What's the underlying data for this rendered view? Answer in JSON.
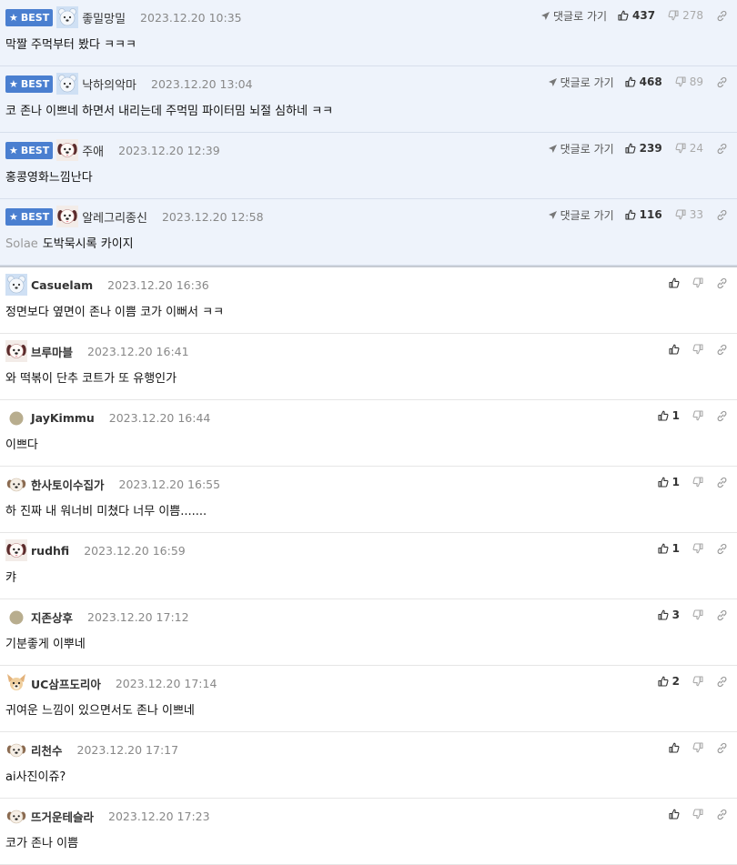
{
  "labels": {
    "best_badge": "BEST",
    "goto_comment": "댓글로 가기"
  },
  "colors": {
    "best_badge_bg": "#4a7fd0",
    "best_row_bg": "#eef3fb"
  },
  "best_comments": [
    {
      "nick": "좋밀망밀",
      "date": "2023.12.20 10:35",
      "text": "막짤 주먹부터 봤다 ㅋㅋㅋ",
      "tag": "",
      "up": "437",
      "down": "278",
      "avatar": "bear-avatar"
    },
    {
      "nick": "낙하의악마",
      "date": "2023.12.20 13:04",
      "text": "코 존나 이쁘네 하면서 내리는데 주먹밈 파이터밈 뇌절 심하네 ㅋㅋ",
      "tag": "",
      "up": "468",
      "down": "89",
      "avatar": "bear-avatar"
    },
    {
      "nick": "주애",
      "date": "2023.12.20 12:39",
      "text": "홍콩영화느낌난다",
      "tag": "",
      "up": "239",
      "down": "24",
      "avatar": "dog-avatar"
    },
    {
      "nick": "알레그리종신",
      "date": "2023.12.20 12:58",
      "text": "도박묵시록 카이지",
      "tag": "Solae",
      "up": "116",
      "down": "33",
      "avatar": "dog-avatar"
    }
  ],
  "comments": [
    {
      "nick": "Casuelam",
      "date": "2023.12.20 16:36",
      "text": "정면보다 옆면이 존나 이쁨 코가 이뻐서 ㅋㅋ",
      "up": "",
      "avatar": "bear-avatar"
    },
    {
      "nick": "브루마블",
      "date": "2023.12.20 16:41",
      "text": "와 떡볶이 단추 코트가 또 유행인가",
      "up": "",
      "avatar": "dog-avatar"
    },
    {
      "nick": "JayKimmu",
      "date": "2023.12.20 16:44",
      "text": "이쁘다",
      "up": "1",
      "avatar": "dot-avatar"
    },
    {
      "nick": "한사토이수집가",
      "date": "2023.12.20 16:55",
      "text": "하 진짜 내 워너비 미쳤다 너무 이쁨.......",
      "up": "1",
      "avatar": "puppy-avatar"
    },
    {
      "nick": "rudhfi",
      "date": "2023.12.20 16:59",
      "text": "캬",
      "up": "1",
      "avatar": "dog-avatar"
    },
    {
      "nick": "지존상후",
      "date": "2023.12.20 17:12",
      "text": "기분좋게 이뿌네",
      "up": "3",
      "avatar": "dot-avatar"
    },
    {
      "nick": "UC삼프도리아",
      "date": "2023.12.20 17:14",
      "text": "귀여운 느낌이 있으면서도 존나 이쁘네",
      "up": "2",
      "avatar": "chihuahua-avatar"
    },
    {
      "nick": "리천수",
      "date": "2023.12.20 17:17",
      "text": "ai사진이쥬?",
      "up": "",
      "avatar": "puppy-avatar"
    },
    {
      "nick": "뜨거운테슬라",
      "date": "2023.12.20 17:23",
      "text": "코가 존나 이쁨",
      "up": "",
      "avatar": "puppy-avatar"
    }
  ]
}
